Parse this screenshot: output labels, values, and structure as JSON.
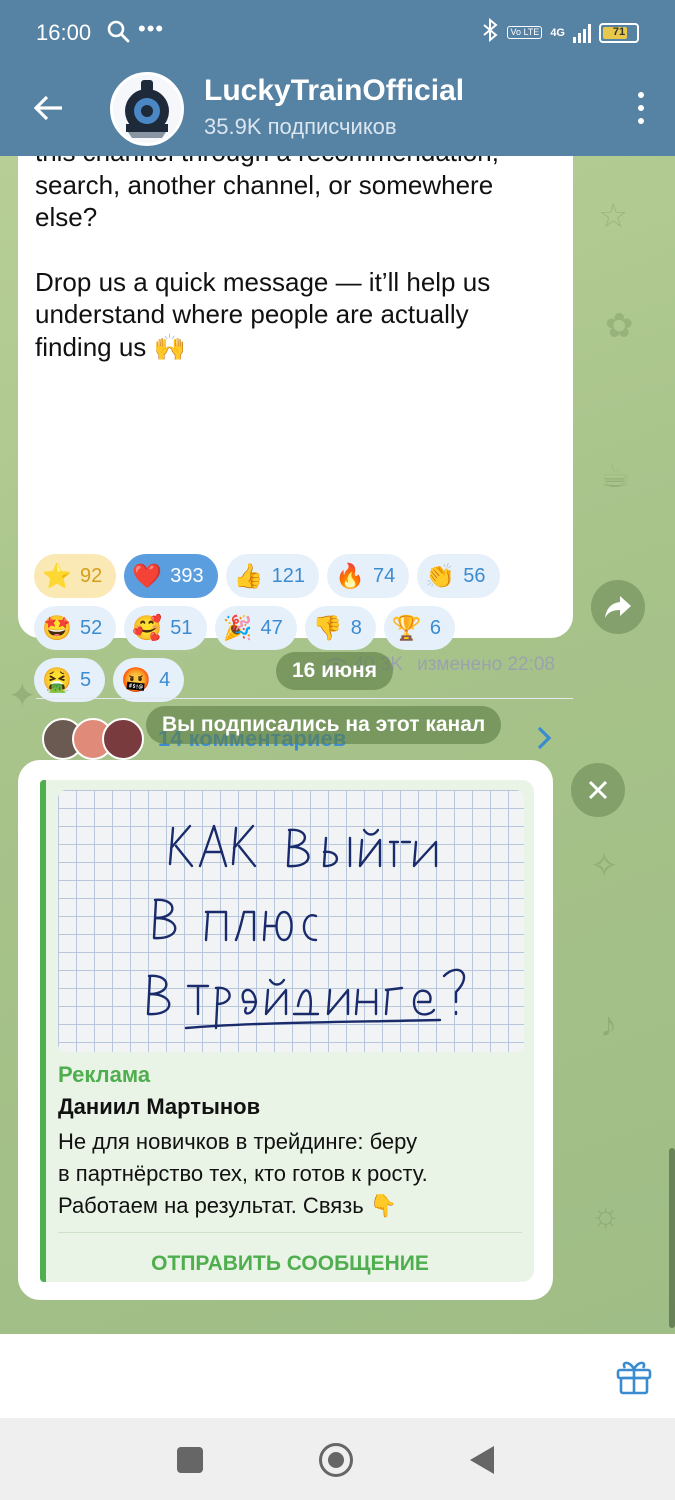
{
  "status_bar": {
    "time": "16:00",
    "battery": "71",
    "network": "4G",
    "volte": "Vo LTE"
  },
  "header": {
    "title": "LuckyTrainOfficial",
    "subtitle": "35.9K подписчиков"
  },
  "post": {
    "text_line_1": "this channel through a recommendation,\nsearch, another channel, or somewhere\nelse?",
    "text_line_2": "Drop us a quick message — it’ll help us\nunderstand where people are actually\nfinding us 🙌",
    "reactions_row1": [
      {
        "emoji": "⭐",
        "count": "92"
      },
      {
        "emoji": "❤️",
        "count": "393"
      },
      {
        "emoji": "👍",
        "count": "121"
      },
      {
        "emoji": "🔥",
        "count": "74"
      },
      {
        "emoji": "👏",
        "count": "56"
      }
    ],
    "reactions_row2": [
      {
        "emoji": "🤩",
        "count": "52"
      },
      {
        "emoji": "🥰",
        "count": "51"
      },
      {
        "emoji": "🎉",
        "count": "47"
      },
      {
        "emoji": "👎",
        "count": "8"
      },
      {
        "emoji": "🏆",
        "count": "6"
      }
    ],
    "reactions_row3": [
      {
        "emoji": "🤮",
        "count": "5"
      },
      {
        "emoji": "🤬",
        "count": "4"
      }
    ],
    "views": "40.3K",
    "edited": "изменено 22:08",
    "comments": "14 комментариев"
  },
  "date_pill": "16 июня",
  "service_pill": "Вы подписались на этот канал",
  "ad": {
    "image_text": "КАК ВЫЙТИ В ПЛЮС В ТРЕЙДИНГЕ?",
    "label": "Реклама",
    "title": "Даниил Мартынов",
    "body": "Не для новичков в трейдинге: беру\nв партнёрство тех, кто готов к росту.\nРаботаем на результат. Связь 👇",
    "button": "ОТПРАВИТЬ СООБЩЕНИЕ"
  },
  "colors": {
    "header": "#5682a3",
    "link": "#3b8bd0",
    "ad_accent": "#4fae4e"
  },
  "icons": [
    "back-arrow-icon",
    "more-vert-icon",
    "eye-icon",
    "chevron-right-icon",
    "share-icon",
    "close-icon",
    "gift-icon"
  ]
}
